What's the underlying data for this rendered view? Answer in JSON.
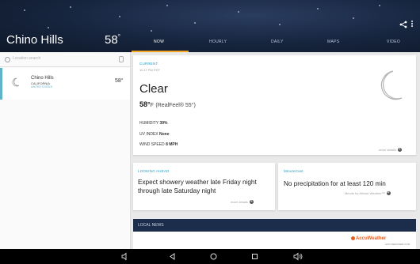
{
  "header": {
    "city": "Chino Hills",
    "temp": "58",
    "temp_unit": "°",
    "tabs": [
      "NOW",
      "HOURLY",
      "DAILY",
      "MAPS",
      "VIDEO"
    ],
    "active_tab": "NOW"
  },
  "sidebar": {
    "search_placeholder": "Location search",
    "locations": [
      {
        "name": "Chino Hills",
        "region": "CALIFORNIA",
        "country": "UNITED STATES",
        "temp": "58°"
      }
    ]
  },
  "current": {
    "label": "CURRENT",
    "time": "11:17 PM PDT",
    "condition": "Clear",
    "temp": "58°",
    "temp_unit": "F",
    "realfeel": "(RealFeel® 55°)",
    "humidity_label": "HUMIDITY",
    "humidity": "39%",
    "uv_label": "UV INDEX",
    "uv": "None",
    "wind_label": "WIND SPEED",
    "wind": "8 MPH",
    "more": "more details"
  },
  "looking_ahead": {
    "label": "LOOKING AHEAD",
    "text": "Expect showery weather late Friday night through late Saturday night",
    "more": "more details"
  },
  "minutecast": {
    "label": "MinuteCast",
    "text": "No precipitation for at least 120 min",
    "more": "Minute by Minute Weather™"
  },
  "news": {
    "label": "LOCAL NEWS"
  },
  "footer": {
    "brand": "AccuWeather",
    "brand_sub": "ACCUWEATHER.COM"
  },
  "colors": {
    "accent": "#1e9fc4",
    "tab_highlight": "#f5a623",
    "header_bg": "#16243d",
    "news_bg": "#1b2d4b"
  }
}
